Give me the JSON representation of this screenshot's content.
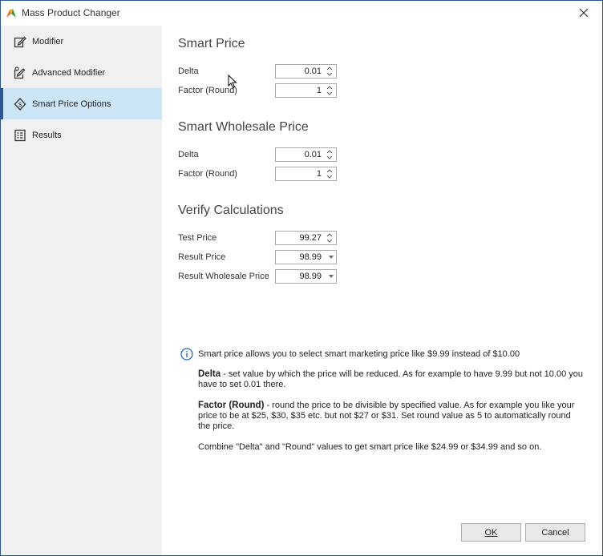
{
  "window": {
    "title": "Mass Product Changer"
  },
  "sidebar": {
    "items": [
      {
        "label": "Modifier",
        "icon": "edit-icon",
        "active": false
      },
      {
        "label": "Advanced Modifier",
        "icon": "advanced-edit-icon",
        "active": false
      },
      {
        "label": "Smart Price Options",
        "icon": "smart-price-icon",
        "active": true
      },
      {
        "label": "Results",
        "icon": "results-icon",
        "active": false
      }
    ]
  },
  "smart_price": {
    "title": "Smart Price",
    "delta_label": "Delta",
    "delta_value": "0.01",
    "factor_label": "Factor (Round)",
    "factor_value": "1"
  },
  "smart_wholesale": {
    "title": "Smart Wholesale Price",
    "delta_label": "Delta",
    "delta_value": "0.01",
    "factor_label": "Factor (Round)",
    "factor_value": "1"
  },
  "verify": {
    "title": "Verify Calculations",
    "test_label": "Test Price",
    "test_value": "99.27",
    "result_label": "Result Price",
    "result_value": "98.99",
    "wholesale_label": "Result Wholesale Price",
    "wholesale_value": "98.99"
  },
  "info": {
    "intro": "Smart price allows you to select smart marketing price like $9.99 instead of $10.00",
    "delta_term": "Delta",
    "delta_text": " - set value by which the price will be reduced. As for example to have 9.99 but not 10.00 you have to set 0.01 there.",
    "factor_term": "Factor (Round)",
    "factor_text": " - round the price to be divisible by specified value. As for example you like your price to be at $25, $30, $35 etc. but not $27 or $31. Set round value as 5 to automatically round the price.",
    "combine_text": "Combine \"Delta\" and \"Round\" values to get smart price like $24.99 or $34.99 and so on."
  },
  "buttons": {
    "ok_label": "OK",
    "cancel_label": "Cancel"
  },
  "colors": {
    "accent": "#2b579a",
    "active_bg": "#cde6f7",
    "sidebar_bg": "#f0f0f0",
    "info_icon": "#2b6cb0"
  }
}
